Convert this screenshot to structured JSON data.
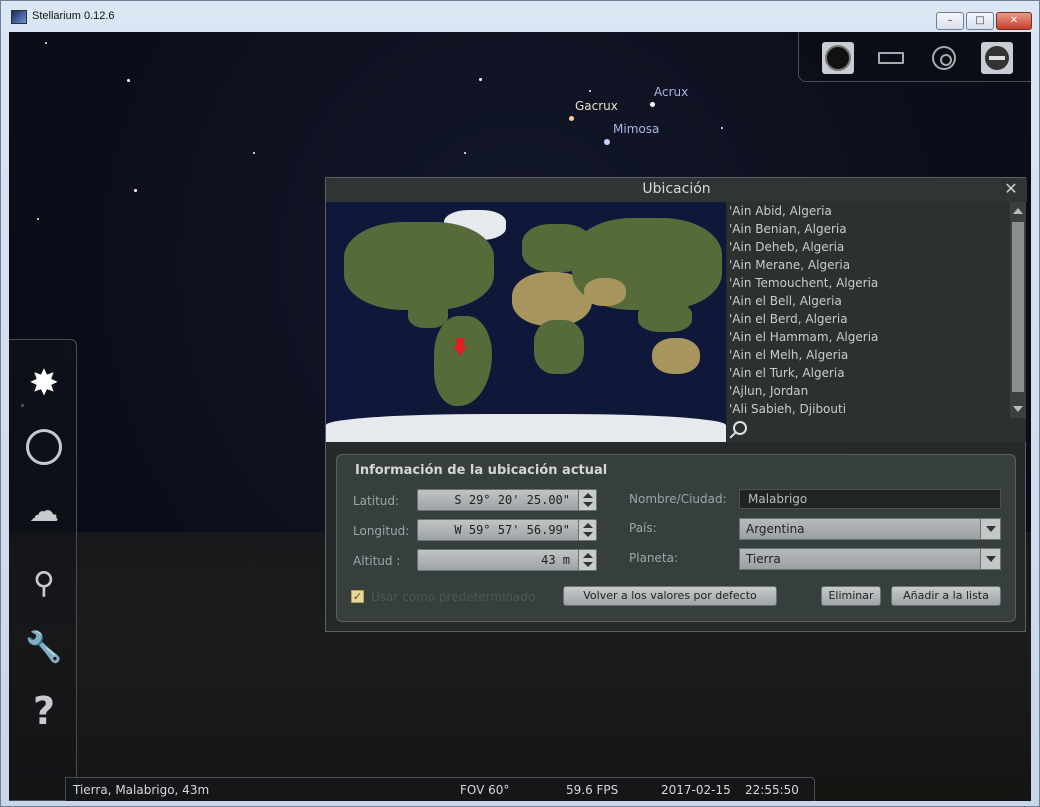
{
  "window": {
    "title": "Stellarium 0.12.6",
    "min_label": "–",
    "max_label": "□",
    "close_label": "✕"
  },
  "sky": {
    "stars": [
      {
        "name": "Acrux",
        "label": "Acrux"
      },
      {
        "name": "Gacrux",
        "label": "Gacrux"
      },
      {
        "name": "Mimosa",
        "label": "Mimosa"
      }
    ]
  },
  "topbar": {
    "icons": [
      "night-mode-icon",
      "fullscreen-icon",
      "target-icon",
      "quit-icon"
    ]
  },
  "sidebar": {
    "icons": [
      "location-icon",
      "datetime-icon",
      "sky-view-icon",
      "search-icon",
      "configuration-icon",
      "help-icon"
    ]
  },
  "dialog": {
    "title": "Ubicación",
    "close_label": "✕",
    "cities": [
      "'Ain Abid, Algeria",
      "'Ain Benian, Algeria",
      "'Ain Deheb, Algeria",
      "'Ain Merane, Algeria",
      "'Ain Temouchent, Algeria",
      "'Ain el Bell, Algeria",
      "'Ain el Berd, Algeria",
      "'Ain el Hammam, Algeria",
      "'Ain el Melh, Algeria",
      "'Ain el Turk, Algeria",
      "'Ajlun, Jordan",
      "'Ali Sabieh, Djibouti"
    ],
    "search": {
      "value": ""
    },
    "info": {
      "title": "Información de la ubicación actual",
      "latitude_label": "Latitud:",
      "latitude_value": "S 29° 20' 25.00\"",
      "longitude_label": "Longitud:",
      "longitude_value": "W 59° 57' 56.99\"",
      "altitude_label": "Altitud :",
      "altitude_value": "43 m",
      "name_label": "Nombre/Ciudad:",
      "name_value": "Malabrigo",
      "country_label": "País:",
      "country_value": "Argentina",
      "planet_label": "Planeta:",
      "planet_value": "Tierra",
      "default_checkbox_label": "Usar como predeterminado",
      "default_checked": true,
      "reset_button": "Volver a los valores por defecto",
      "delete_button": "Eliminar",
      "add_button": "Añadir a la lista"
    }
  },
  "statusbar": {
    "location": "Tierra, Malabrigo, 43m",
    "fov": "FOV 60°",
    "fps": "59.6 FPS",
    "date": "2017-02-15",
    "time": "22:55:50"
  }
}
